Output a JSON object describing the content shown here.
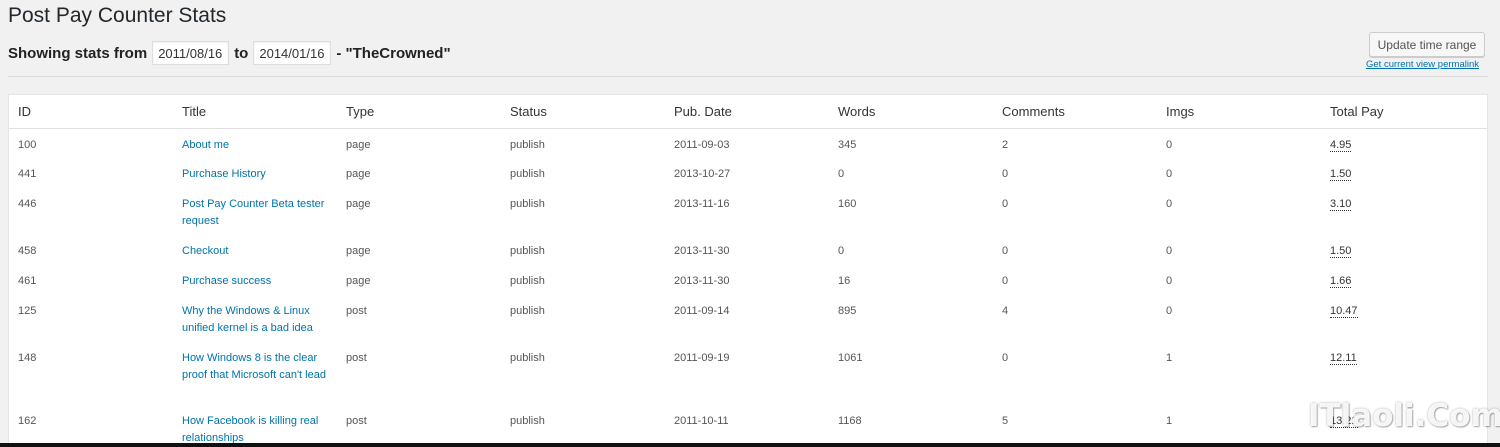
{
  "page_title": "Post Pay Counter Stats",
  "range": {
    "showing_label": "Showing stats from",
    "from_date": "2011/08/16",
    "to_label": "to",
    "to_date": "2014/01/16",
    "author_label": "- \"TheCrowned\""
  },
  "actions": {
    "update_button": "Update time range",
    "permalink": "Get current view permalink"
  },
  "table": {
    "columns": [
      "ID",
      "Title",
      "Type",
      "Status",
      "Pub. Date",
      "Words",
      "Comments",
      "Imgs",
      "Total Pay"
    ],
    "rows": [
      {
        "id": "100",
        "title": "About me",
        "type": "page",
        "status": "publish",
        "date": "2011-09-03",
        "words": "345",
        "comments": "2",
        "imgs": "0",
        "pay": "4.95"
      },
      {
        "id": "441",
        "title": "Purchase History",
        "type": "page",
        "status": "publish",
        "date": "2013-10-27",
        "words": "0",
        "comments": "0",
        "imgs": "0",
        "pay": "1.50"
      },
      {
        "id": "446",
        "title": "Post Pay Counter Beta tester request",
        "type": "page",
        "status": "publish",
        "date": "2013-11-16",
        "words": "160",
        "comments": "0",
        "imgs": "0",
        "pay": "3.10"
      },
      {
        "id": "458",
        "title": "Checkout",
        "type": "page",
        "status": "publish",
        "date": "2013-11-30",
        "words": "0",
        "comments": "0",
        "imgs": "0",
        "pay": "1.50"
      },
      {
        "id": "461",
        "title": "Purchase success",
        "type": "page",
        "status": "publish",
        "date": "2013-11-30",
        "words": "16",
        "comments": "0",
        "imgs": "0",
        "pay": "1.66"
      },
      {
        "id": "125",
        "title": "Why the Windows & Linux unified kernel is a bad idea",
        "type": "post",
        "status": "publish",
        "date": "2011-09-14",
        "words": "895",
        "comments": "4",
        "imgs": "0",
        "pay": "10.47"
      },
      {
        "id": "148",
        "title": "How Windows 8 is the clear proof that Microsoft can't lead",
        "type": "post",
        "status": "publish",
        "date": "2011-09-19",
        "words": "1061",
        "comments": "0",
        "imgs": "1",
        "pay": "12.11"
      },
      {
        "id": "162",
        "title": "How Facebook is killing real relationships",
        "type": "post",
        "status": "publish",
        "date": "2011-10-11",
        "words": "1168",
        "comments": "5",
        "imgs": "1",
        "pay": "13.21"
      }
    ]
  },
  "watermark": "ITlaoli.Com"
}
